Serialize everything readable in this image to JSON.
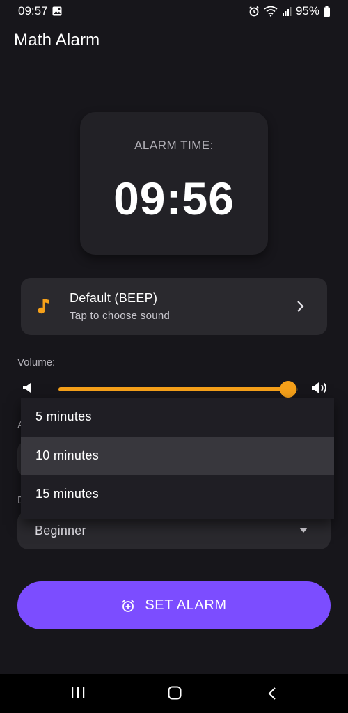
{
  "status_bar": {
    "time": "09:57",
    "battery": "95%"
  },
  "app": {
    "title": "Math Alarm"
  },
  "alarm": {
    "label": "ALARM TIME:",
    "time": "09:56"
  },
  "sound": {
    "title": "Default (BEEP)",
    "subtitle": "Tap to choose sound",
    "icon": "music-note-icon"
  },
  "volume": {
    "label": "Volume:",
    "level": 0.96
  },
  "fields": {
    "hidden_label_1_initial": "A",
    "difficulty_label_initial": "D",
    "difficulty_value": "Beginner"
  },
  "dropdown": {
    "options": [
      "5 minutes",
      "10 minutes",
      "15 minutes"
    ],
    "selected_index": 1
  },
  "actions": {
    "set_alarm_label": "SET ALARM"
  },
  "colors": {
    "accent": "#f5a01a",
    "primary": "#7c4dff",
    "background": "#17161b"
  }
}
